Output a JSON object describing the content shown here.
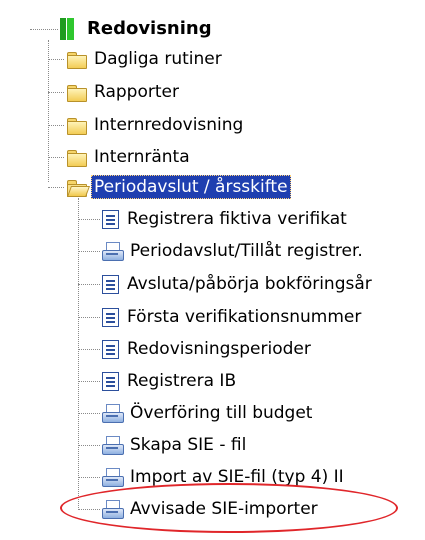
{
  "tree": {
    "root": {
      "label": "Redovisning",
      "icon": "book-icon"
    },
    "folders": [
      {
        "label": "Dagliga rutiner",
        "icon": "folder-icon"
      },
      {
        "label": "Rapporter",
        "icon": "folder-icon"
      },
      {
        "label": "Internredovisning",
        "icon": "folder-icon"
      },
      {
        "label": "Internränta",
        "icon": "folder-icon"
      },
      {
        "label": "Periodavslut / årsskifte",
        "icon": "folder-open-icon",
        "selected": true
      }
    ],
    "items": [
      {
        "label": "Registrera fiktiva verifikat",
        "icon": "document-icon"
      },
      {
        "label": "Periodavslut/Tillåt registrer.",
        "icon": "report-icon"
      },
      {
        "label": "Avsluta/påbörja bokföringsår",
        "icon": "document-icon"
      },
      {
        "label": "Första verifikationsnummer",
        "icon": "document-icon"
      },
      {
        "label": "Redovisningsperioder",
        "icon": "document-icon"
      },
      {
        "label": "Registrera IB",
        "icon": "document-icon"
      },
      {
        "label": "Överföring till budget",
        "icon": "report-icon"
      },
      {
        "label": "Skapa SIE - fil",
        "icon": "report-icon"
      },
      {
        "label": "Import av SIE-fil (typ 4) II",
        "icon": "report-icon"
      },
      {
        "label": "Avvisade SIE-importer",
        "icon": "report-icon",
        "highlighted": true
      }
    ]
  },
  "colors": {
    "selection": "#1f3fb0",
    "highlight_ring": "#e0262a"
  }
}
